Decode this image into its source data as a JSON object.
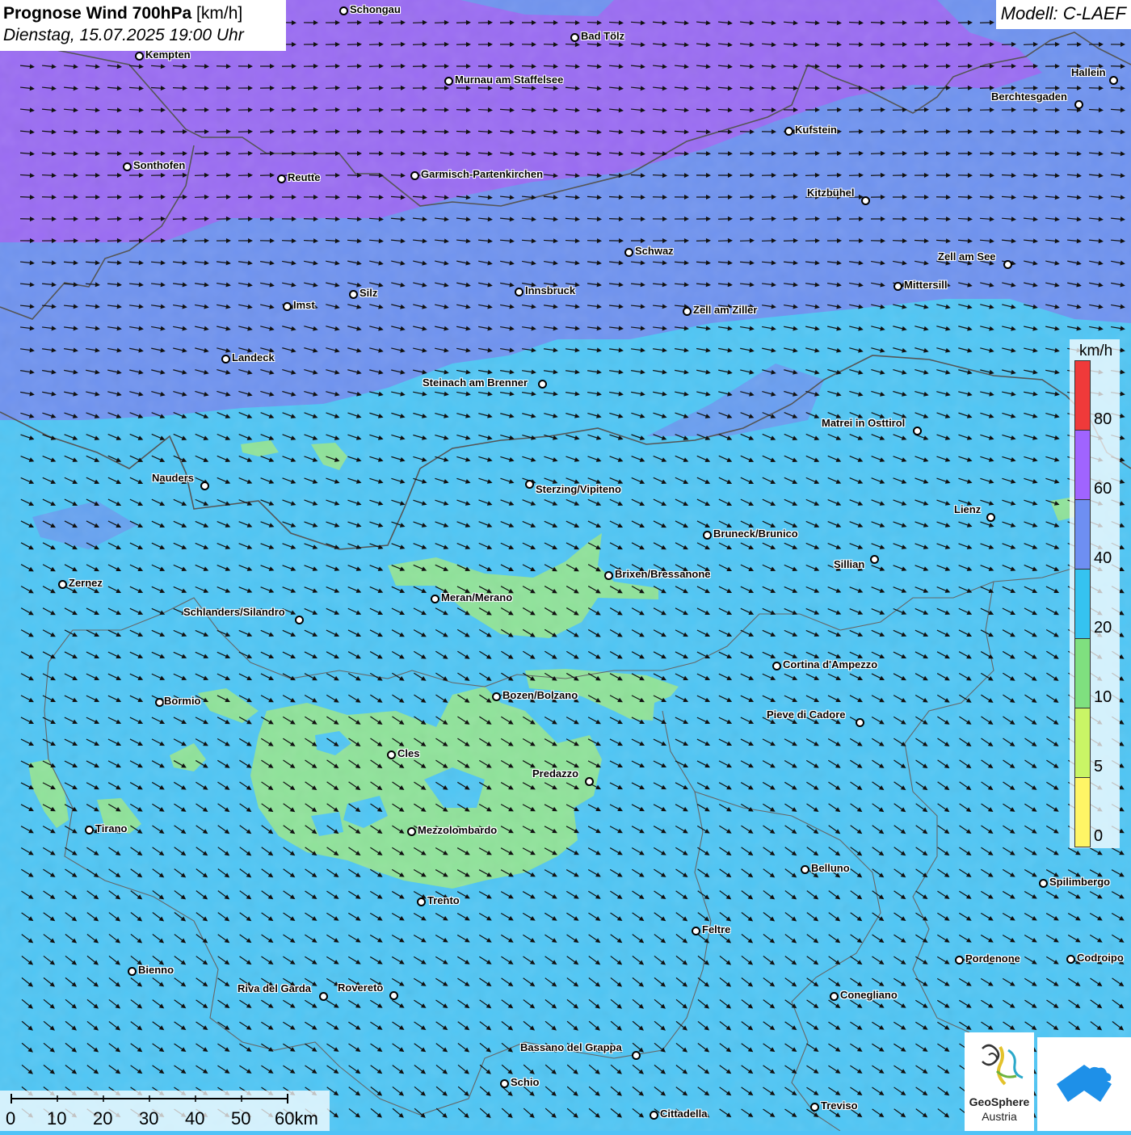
{
  "header": {
    "title_bold": "Prognose Wind 700hPa",
    "title_unit": "[km/h]",
    "datetime": "Dienstag, 15.07.2025 19:00 Uhr",
    "model": "Modell: C-LAEF"
  },
  "legend": {
    "unit": "km/h",
    "labels": [
      "80",
      "60",
      "40",
      "20",
      "10",
      "5",
      "0"
    ],
    "colors": [
      "#ef3a3a",
      "#a064ff",
      "#6e8ff2",
      "#35c3f0",
      "#7fe07f",
      "#c9f566",
      "#fff566"
    ]
  },
  "scalebar": {
    "labels": [
      "0",
      "10",
      "20",
      "30",
      "40",
      "50",
      "60km"
    ]
  },
  "logos": {
    "geosphere_line1": "GeoSphere",
    "geosphere_line2": "Austria"
  },
  "cities": [
    {
      "name": "Schongau"
    },
    {
      "name": "Bad Tölz"
    },
    {
      "name": "Kempten"
    },
    {
      "name": "Murnau am Staffelsee"
    },
    {
      "name": "Hallein"
    },
    {
      "name": "Berchtesgaden"
    },
    {
      "name": "Kufstein"
    },
    {
      "name": "Sonthofen"
    },
    {
      "name": "Reutte"
    },
    {
      "name": "Garmisch-Partenkirchen"
    },
    {
      "name": "Kitzbühel"
    },
    {
      "name": "Schwaz"
    },
    {
      "name": "Zell am See"
    },
    {
      "name": "Mittersill"
    },
    {
      "name": "Silz"
    },
    {
      "name": "Innsbruck"
    },
    {
      "name": "Imst"
    },
    {
      "name": "Zell am Ziller"
    },
    {
      "name": "Landeck"
    },
    {
      "name": "Steinach am Brenner"
    },
    {
      "name": "Matrei in Osttirol"
    },
    {
      "name": "Nauders"
    },
    {
      "name": "Sterzing/Vipiteno"
    },
    {
      "name": "Lienz"
    },
    {
      "name": "Bruneck/Brunico"
    },
    {
      "name": "Sillian"
    },
    {
      "name": "Brixen/Bressanone"
    },
    {
      "name": "Zernez"
    },
    {
      "name": "Meran/Merano"
    },
    {
      "name": "Schlanders/Silandro"
    },
    {
      "name": "Cortina d'Ampezzo"
    },
    {
      "name": "Bormio"
    },
    {
      "name": "Bozen/Bolzano"
    },
    {
      "name": "Pieve di Cadore"
    },
    {
      "name": "Cles"
    },
    {
      "name": "Predazzo"
    },
    {
      "name": "Tirano"
    },
    {
      "name": "Mezzolombardo"
    },
    {
      "name": "Belluno"
    },
    {
      "name": "Spilimbergo"
    },
    {
      "name": "Trento"
    },
    {
      "name": "Feltre"
    },
    {
      "name": "Bienno"
    },
    {
      "name": "Pordenone"
    },
    {
      "name": "Codroipo"
    },
    {
      "name": "Riva del Garda"
    },
    {
      "name": "Rovereto"
    },
    {
      "name": "Conegliano"
    },
    {
      "name": "Bassano del Grappa"
    },
    {
      "name": "Schio"
    },
    {
      "name": "Treviso"
    },
    {
      "name": "Cittadella"
    }
  ]
}
